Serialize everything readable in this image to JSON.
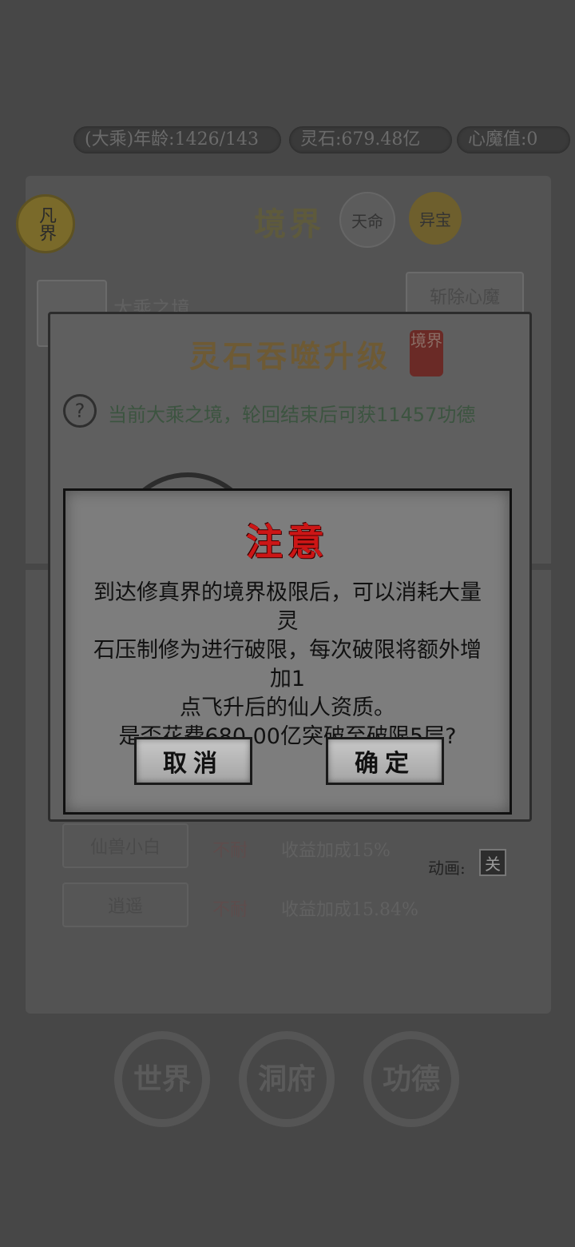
{
  "status_bar": {
    "age": "(大乘)年龄:1426/143",
    "spirit_stones": "灵石:679.48亿",
    "heart_demon": "心魔值:0"
  },
  "background": {
    "avatar_label": "凡界",
    "realm_title": "境界",
    "fate_button": "天命",
    "treasure_button": "异宝",
    "realm_name": "大乘之境",
    "cut_demon_button": "斩除心魔",
    "rows": [
      {
        "tag": "仙兽小白",
        "status": "不耐",
        "bonus": "收益加成15%"
      },
      {
        "tag": "逍遥",
        "status": "不耐",
        "bonus": "收益加成15.84%"
      }
    ],
    "animation_label": "动画:",
    "animation_toggle": "关"
  },
  "upgrade_panel": {
    "title": "灵石吞噬升级",
    "seal": "境界",
    "info": "当前大乘之境，轮回结束后可获11457功德"
  },
  "dialog": {
    "title": "注意",
    "line1": "到达修真界的境界极限后，可以消耗大量灵",
    "line2": "石压制修为进行破限，每次破限将额外增加1",
    "line3": "点飞升后的仙人资质。",
    "line4": "是否花费680.00亿突破至破限5层?",
    "cancel_label": "取消",
    "confirm_label": "确定"
  },
  "bottom_nav": {
    "world": "世界",
    "cave": "洞府",
    "merit": "功德"
  },
  "colors": {
    "dialog_title": "#cc1616",
    "overlay": "#474747"
  }
}
